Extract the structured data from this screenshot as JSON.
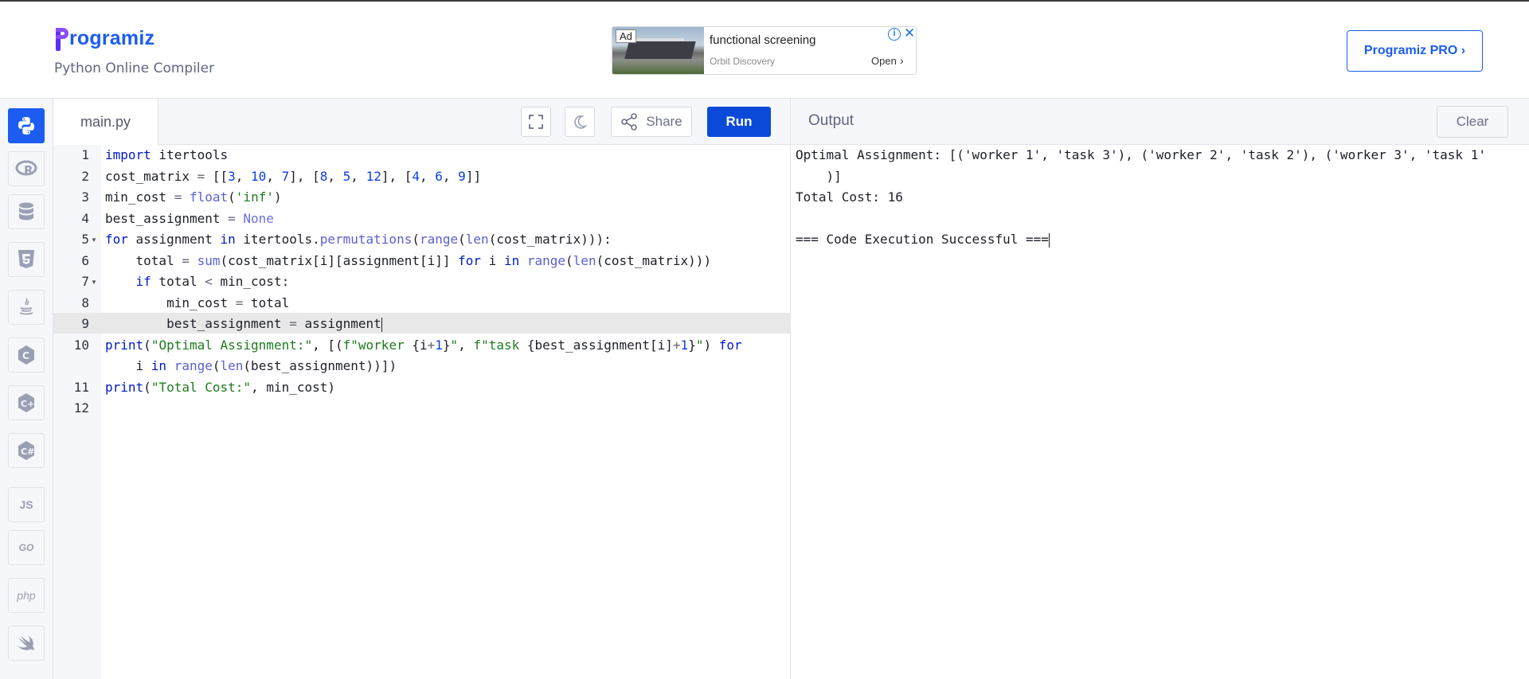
{
  "header": {
    "brand": "rogramiz",
    "subtitle": "Python Online Compiler",
    "pro_button": "Programiz PRO ›"
  },
  "ad": {
    "badge": "Ad",
    "title": "functional screening",
    "source": "Orbit Discovery",
    "open": "Open",
    "info_icon": "i",
    "close_icon": "✕",
    "chevron": "›"
  },
  "sidebar": {
    "items": [
      {
        "name": "python",
        "label": "py",
        "active": true
      },
      {
        "name": "r",
        "label": "R"
      },
      {
        "name": "sql",
        "label": "SQL"
      },
      {
        "name": "html",
        "label": "5"
      },
      {
        "name": "java",
        "label": "☕"
      },
      {
        "name": "c",
        "label": "C"
      },
      {
        "name": "cpp",
        "label": "C+"
      },
      {
        "name": "csharp",
        "label": "C#"
      },
      {
        "name": "javascript",
        "label": "JS"
      },
      {
        "name": "go",
        "label": "GO"
      },
      {
        "name": "php",
        "label": "php"
      },
      {
        "name": "swift",
        "label": "➶"
      }
    ]
  },
  "editor": {
    "file_name": "main.py",
    "share_label": "Share",
    "run_label": "Run",
    "line_numbers": [
      "1",
      "2",
      "3",
      "4",
      "5",
      "6",
      "7",
      "8",
      "9",
      "10",
      "",
      "11",
      "12"
    ]
  },
  "output": {
    "title": "Output",
    "clear_label": "Clear",
    "lines": [
      "Optimal Assignment: [('worker 1', 'task 3'), ('worker 2', 'task 2'), ('worker 3', 'task 1'",
      "    )]",
      "Total Cost: 16",
      "",
      "=== Code Execution Successful ==="
    ]
  },
  "colors": {
    "accent": "#1c5cf0",
    "run": "#0b4ad8",
    "keyword": "#0019c7",
    "string": "#1e7a1e"
  }
}
